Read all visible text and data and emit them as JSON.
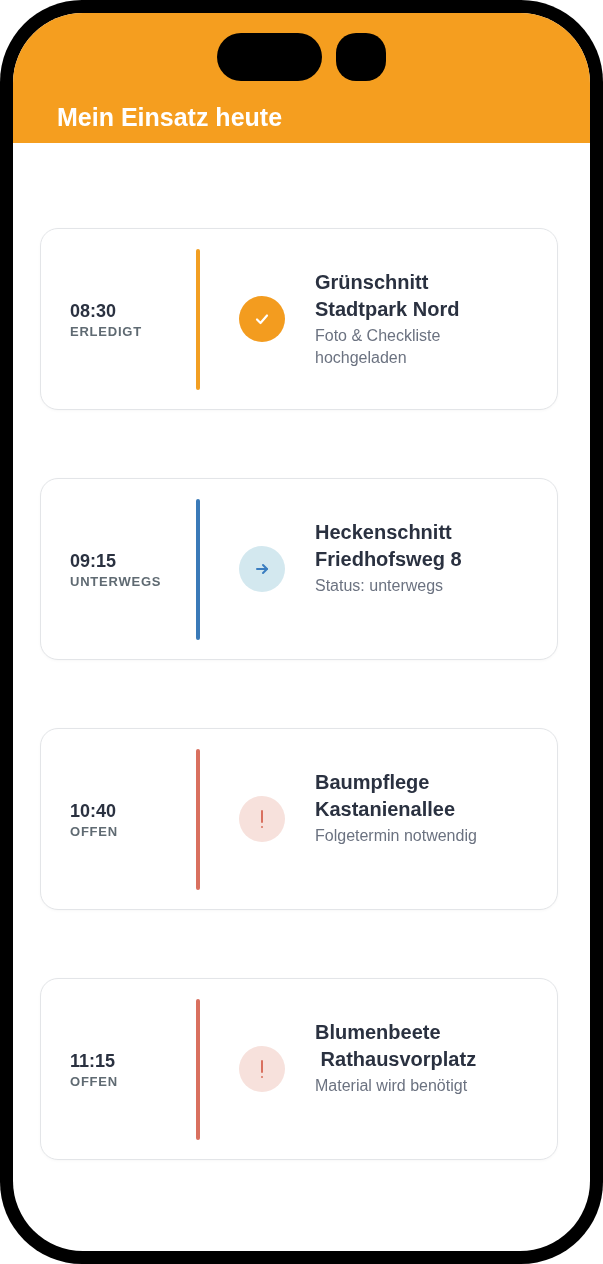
{
  "header": {
    "title": "Mein Einsatz heute"
  },
  "tasks": [
    {
      "time": "08:30",
      "status": "ERLEDIGT",
      "kind": "done",
      "color": "#f29f22",
      "title": "Grünschnitt\nStadtpark Nord",
      "subtitle": "Foto & Checkliste hochgeladen"
    },
    {
      "time": "09:15",
      "status": "UNTERWEGS",
      "kind": "enroute",
      "color": "#3a7ab8",
      "title": "Heckenschnitt\nFriedhofsweg 8",
      "subtitle": "Status: unterwegs"
    },
    {
      "time": "10:40",
      "status": "OFFEN",
      "kind": "open",
      "color": "#d9705f",
      "title": "Baumpflege\nKastanienallee",
      "subtitle": "Folgetermin notwendig"
    },
    {
      "time": "11:15",
      "status": "OFFEN",
      "kind": "open",
      "color": "#d9705f",
      "title": "Blumenbeete\n Rathausvorplatz",
      "subtitle": "Material wird benötigt"
    }
  ]
}
